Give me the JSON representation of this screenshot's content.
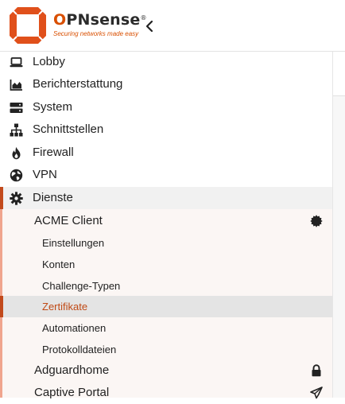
{
  "brand": {
    "name_prefix": "O",
    "name_main": "PNsense",
    "trademark": "®",
    "tagline": "Securing networks made easy",
    "accent_color": "#d94f00"
  },
  "header": {
    "collapse_icon": "chevron-left-icon"
  },
  "sidebar": {
    "items": [
      {
        "label": "Lobby",
        "icon": "laptop-icon"
      },
      {
        "label": "Berichterstattung",
        "icon": "area-chart-icon"
      },
      {
        "label": "System",
        "icon": "server-icon"
      },
      {
        "label": "Schnittstellen",
        "icon": "sitemap-icon"
      },
      {
        "label": "Firewall",
        "icon": "fire-icon"
      },
      {
        "label": "VPN",
        "icon": "globe-icon"
      },
      {
        "label": "Dienste",
        "icon": "gear-icon",
        "expanded": true
      }
    ],
    "dienste_children": [
      {
        "label": "ACME Client",
        "icon": "certificate-icon",
        "expanded": true
      },
      {
        "label": "Adguardhome",
        "icon": "lock-icon"
      },
      {
        "label": "Captive Portal",
        "icon": "paper-plane-icon"
      }
    ],
    "acme_children": [
      {
        "label": "Einstellungen"
      },
      {
        "label": "Konten"
      },
      {
        "label": "Challenge-Typen"
      },
      {
        "label": "Zertifikate",
        "active": true
      },
      {
        "label": "Automationen"
      },
      {
        "label": "Protokolldateien"
      }
    ]
  }
}
